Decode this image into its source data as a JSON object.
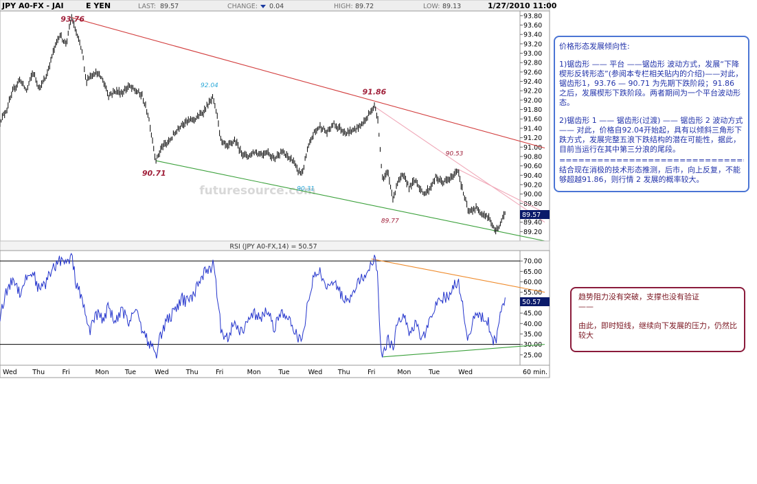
{
  "header": {
    "symbol": "JPY A0-FX - JAI",
    "currency": "E YEN",
    "last_label": "LAST:",
    "last_value": "89.57",
    "change_label": "CHANGE:",
    "change_value": "0.04",
    "high_label": "HIGH:",
    "high_value": "89.72",
    "low_label": "LOW:",
    "low_value": "89.13",
    "datetime": "1/27/2010 11:00"
  },
  "watermark": "futuresource.com",
  "last_price_tag": "89.57",
  "rsi_title": "RSI (JPY A0-FX,14) = 50.57",
  "rsi_value_tag": "50.57",
  "chart_data": [
    {
      "type": "candlestick",
      "title": "JPY A0-FX - JAI",
      "ylim": [
        89.0,
        93.9
      ],
      "y_ticks": [
        "93.80",
        "93.60",
        "93.40",
        "93.20",
        "93.00",
        "92.80",
        "92.60",
        "92.40",
        "92.20",
        "92.00",
        "91.80",
        "91.60",
        "91.40",
        "91.20",
        "91.00",
        "90.80",
        "90.60",
        "90.40",
        "90.20",
        "90.00",
        "89.80",
        "89.60",
        "89.40",
        "89.20"
      ],
      "x_ticks": [
        "Wed",
        "Thu",
        "Fri",
        "Mon",
        "Tue",
        "Wed",
        "Thu",
        "Fri",
        "Mon",
        "Tue",
        "Wed",
        "Thu",
        "Fri",
        "Mon",
        "Tue",
        "Wed",
        "60 min."
      ],
      "key_points": [
        {
          "label": "93.76",
          "x": 0.217,
          "y": 93.76
        },
        {
          "label": "90.71",
          "x": 0.472,
          "y": 90.71
        },
        {
          "label": "92.04",
          "x": 0.645,
          "y": 92.04
        },
        {
          "label": "90.31",
          "x": 0.916,
          "y": 90.31
        },
        {
          "label": "91.86",
          "x": 1.135,
          "y": 91.86
        },
        {
          "label": "89.77",
          "x": 1.192,
          "y": 89.77
        },
        {
          "label": "90.53",
          "x": 1.387,
          "y": 90.53
        },
        {
          "label": "89.57",
          "x": 1.53,
          "y": 89.57
        }
      ],
      "anchors": [
        [
          0.0,
          91.55
        ],
        [
          0.02,
          91.8
        ],
        [
          0.04,
          92.2
        ],
        [
          0.06,
          92.45
        ],
        [
          0.08,
          92.2
        ],
        [
          0.1,
          92.6
        ],
        [
          0.12,
          92.25
        ],
        [
          0.14,
          92.5
        ],
        [
          0.16,
          93.0
        ],
        [
          0.18,
          93.4
        ],
        [
          0.2,
          93.2
        ],
        [
          0.217,
          93.76
        ],
        [
          0.23,
          93.45
        ],
        [
          0.25,
          93.0
        ],
        [
          0.26,
          92.4
        ],
        [
          0.27,
          92.5
        ],
        [
          0.29,
          92.6
        ],
        [
          0.31,
          92.45
        ],
        [
          0.33,
          92.1
        ],
        [
          0.35,
          92.2
        ],
        [
          0.37,
          92.15
        ],
        [
          0.39,
          92.3
        ],
        [
          0.41,
          92.2
        ],
        [
          0.43,
          92.1
        ],
        [
          0.45,
          91.65
        ],
        [
          0.472,
          90.71
        ],
        [
          0.49,
          91.0
        ],
        [
          0.51,
          91.1
        ],
        [
          0.53,
          91.3
        ],
        [
          0.55,
          91.5
        ],
        [
          0.57,
          91.55
        ],
        [
          0.59,
          91.6
        ],
        [
          0.61,
          91.7
        ],
        [
          0.63,
          91.9
        ],
        [
          0.645,
          92.04
        ],
        [
          0.66,
          91.6
        ],
        [
          0.67,
          91.1
        ],
        [
          0.69,
          91.0
        ],
        [
          0.71,
          91.15
        ],
        [
          0.73,
          90.9
        ],
        [
          0.75,
          90.8
        ],
        [
          0.77,
          90.9
        ],
        [
          0.79,
          90.85
        ],
        [
          0.81,
          90.9
        ],
        [
          0.83,
          90.75
        ],
        [
          0.85,
          90.9
        ],
        [
          0.87,
          90.8
        ],
        [
          0.89,
          90.7
        ],
        [
          0.9,
          90.5
        ],
        [
          0.916,
          90.45
        ],
        [
          0.93,
          90.9
        ],
        [
          0.95,
          91.3
        ],
        [
          0.97,
          91.45
        ],
        [
          0.99,
          91.3
        ],
        [
          1.01,
          91.5
        ],
        [
          1.03,
          91.4
        ],
        [
          1.05,
          91.3
        ],
        [
          1.07,
          91.35
        ],
        [
          1.09,
          91.45
        ],
        [
          1.11,
          91.6
        ],
        [
          1.125,
          91.8
        ],
        [
          1.135,
          91.86
        ],
        [
          1.145,
          91.6
        ],
        [
          1.15,
          91.1
        ],
        [
          1.155,
          90.6
        ],
        [
          1.16,
          90.3
        ],
        [
          1.175,
          90.45
        ],
        [
          1.192,
          89.85
        ],
        [
          1.2,
          90.2
        ],
        [
          1.22,
          90.4
        ],
        [
          1.24,
          90.15
        ],
        [
          1.26,
          90.3
        ],
        [
          1.28,
          90.0
        ],
        [
          1.3,
          90.1
        ],
        [
          1.32,
          90.35
        ],
        [
          1.34,
          90.25
        ],
        [
          1.36,
          90.3
        ],
        [
          1.375,
          90.4
        ],
        [
          1.387,
          90.53
        ],
        [
          1.4,
          90.1
        ],
        [
          1.41,
          89.85
        ],
        [
          1.42,
          89.6
        ],
        [
          1.44,
          89.7
        ],
        [
          1.46,
          89.6
        ],
        [
          1.48,
          89.5
        ],
        [
          1.49,
          89.35
        ],
        [
          1.5,
          89.2
        ],
        [
          1.51,
          89.3
        ],
        [
          1.52,
          89.45
        ],
        [
          1.53,
          89.57
        ]
      ],
      "trendlines": [
        {
          "name": "resistance",
          "color": "#d23c3c",
          "from": [
            0.217,
            93.76
          ],
          "to": [
            1.65,
            90.98
          ]
        },
        {
          "name": "support",
          "color": "#3aa03a",
          "from": [
            0.472,
            90.71
          ],
          "to": [
            1.65,
            89.0
          ]
        },
        {
          "name": "wedge-upper",
          "color": "#f0a8b8",
          "from": [
            1.135,
            91.86
          ],
          "to": [
            1.65,
            89.4
          ]
        },
        {
          "name": "wedge-mid",
          "color": "#f0a8b8",
          "from": [
            1.387,
            90.53
          ],
          "to": [
            1.65,
            89.6
          ]
        }
      ]
    },
    {
      "type": "line",
      "title": "RSI (JPY A0-FX,14) = 50.57",
      "ylim": [
        20,
        75
      ],
      "y_ticks": [
        "70.00",
        "65.00",
        "60.00",
        "55.00",
        "50.00",
        "45.00",
        "40.00",
        "35.00",
        "30.00",
        "25.00"
      ],
      "hlines": [
        70,
        30
      ],
      "anchors": [
        [
          0.0,
          44
        ],
        [
          0.02,
          55
        ],
        [
          0.04,
          62
        ],
        [
          0.06,
          55
        ],
        [
          0.08,
          62
        ],
        [
          0.1,
          65
        ],
        [
          0.12,
          55
        ],
        [
          0.14,
          60
        ],
        [
          0.16,
          66
        ],
        [
          0.18,
          71
        ],
        [
          0.2,
          68
        ],
        [
          0.217,
          72
        ],
        [
          0.23,
          60
        ],
        [
          0.25,
          50
        ],
        [
          0.27,
          36
        ],
        [
          0.29,
          45
        ],
        [
          0.31,
          42
        ],
        [
          0.33,
          48
        ],
        [
          0.35,
          40
        ],
        [
          0.37,
          46
        ],
        [
          0.39,
          41
        ],
        [
          0.41,
          48
        ],
        [
          0.43,
          38
        ],
        [
          0.45,
          31
        ],
        [
          0.472,
          25
        ],
        [
          0.49,
          36
        ],
        [
          0.51,
          43
        ],
        [
          0.53,
          45
        ],
        [
          0.55,
          52
        ],
        [
          0.57,
          50
        ],
        [
          0.59,
          55
        ],
        [
          0.61,
          63
        ],
        [
          0.63,
          66
        ],
        [
          0.645,
          68
        ],
        [
          0.66,
          52
        ],
        [
          0.67,
          36
        ],
        [
          0.69,
          34
        ],
        [
          0.71,
          41
        ],
        [
          0.73,
          36
        ],
        [
          0.75,
          40
        ],
        [
          0.77,
          45
        ],
        [
          0.79,
          42
        ],
        [
          0.81,
          46
        ],
        [
          0.83,
          38
        ],
        [
          0.85,
          45
        ],
        [
          0.87,
          42
        ],
        [
          0.89,
          38
        ],
        [
          0.9,
          33
        ],
        [
          0.916,
          32
        ],
        [
          0.93,
          48
        ],
        [
          0.95,
          62
        ],
        [
          0.97,
          66
        ],
        [
          0.99,
          56
        ],
        [
          1.01,
          62
        ],
        [
          1.03,
          55
        ],
        [
          1.05,
          50
        ],
        [
          1.07,
          56
        ],
        [
          1.09,
          60
        ],
        [
          1.11,
          65
        ],
        [
          1.125,
          70
        ],
        [
          1.135,
          71
        ],
        [
          1.145,
          60
        ],
        [
          1.15,
          40
        ],
        [
          1.155,
          28
        ],
        [
          1.16,
          24
        ],
        [
          1.175,
          32
        ],
        [
          1.192,
          27
        ],
        [
          1.2,
          40
        ],
        [
          1.22,
          45
        ],
        [
          1.24,
          36
        ],
        [
          1.26,
          41
        ],
        [
          1.28,
          32
        ],
        [
          1.3,
          40
        ],
        [
          1.32,
          50
        ],
        [
          1.34,
          52
        ],
        [
          1.36,
          54
        ],
        [
          1.375,
          58
        ],
        [
          1.387,
          61
        ],
        [
          1.4,
          50
        ],
        [
          1.41,
          38
        ],
        [
          1.42,
          32
        ],
        [
          1.44,
          45
        ],
        [
          1.46,
          43
        ],
        [
          1.48,
          40
        ],
        [
          1.49,
          34
        ],
        [
          1.5,
          30
        ],
        [
          1.51,
          40
        ],
        [
          1.52,
          48
        ],
        [
          1.53,
          50.57
        ]
      ],
      "trendlines": [
        {
          "name": "rsi-resistance",
          "color": "#ef8a2a",
          "from": [
            1.125,
            71
          ],
          "to": [
            1.65,
            55
          ]
        },
        {
          "name": "rsi-support",
          "color": "#3aa03a",
          "from": [
            1.16,
            24
          ],
          "to": [
            1.65,
            30
          ]
        }
      ]
    }
  ],
  "note_blue": {
    "line1": "价格形态发展倾向性:",
    "para1": "1)锯齿形 —— 平台 ——锯齿形 波动方式，发展“下降楔形反转形态”(参阅本专栏相关贴内的介绍)——对此，锯齿形1，93.76 — 90.71 为先期下跌阶段；91.86 之后，发展楔形下跌阶段。两者期间为一个平台波动形态。",
    "para2": "2)锯齿形 1 —— 锯齿形(过渡) —— 锯齿形 2 波动方式 —— 对此，价格自92.04开始起，具有以倾斜三角形下跌方式，发展完整五浪下跌结构的潜在可能性，据此，目前当运行在其中第三分浪的尾段。",
    "sep": "================================",
    "para3": "结合现在消极的技术形态推测，后市，向上反复，不能够超越91.86，则行情 2 发展的概率较大。"
  },
  "note_red": {
    "line1": "趋势阻力没有突破，支撑也没有验证",
    "line2": "——",
    "line3": "由此，即时短线，继续向下发展的压力，仍然比较大"
  },
  "colors": {
    "price": "#000000",
    "rsi": "#2233cc",
    "resistance": "#d23c3c",
    "support": "#3aa03a",
    "wedge": "#f0a8b8",
    "rsi_res": "#ef8a2a",
    "label_dark": "#a0203a",
    "label_cyan": "#2aa8d8",
    "tag": "#0a1a6a"
  }
}
